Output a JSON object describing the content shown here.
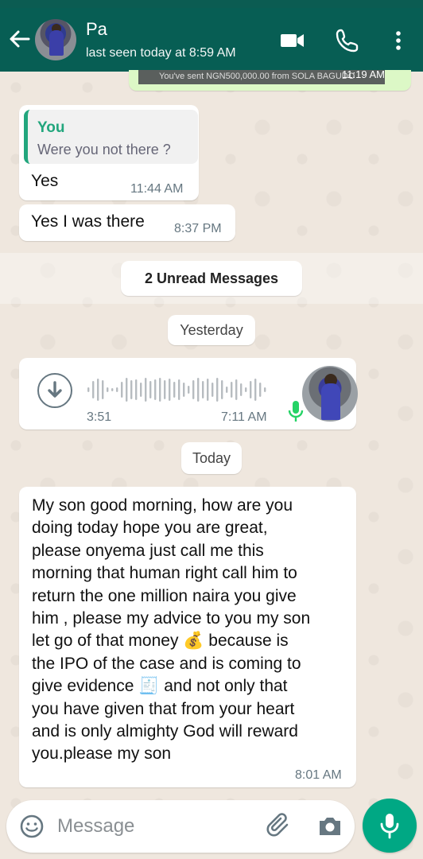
{
  "header": {
    "contact_name": "Pa",
    "last_seen": "last seen today at 8:59 AM"
  },
  "sent_preview": {
    "text": "You've sent NGN500,000.00 from SOLA BAGUDO",
    "time": "11:19 AM"
  },
  "messages": [
    {
      "reply_author": "You",
      "reply_text": "Were you not there ?",
      "text": "Yes",
      "time": "11:44 AM"
    },
    {
      "text": "Yes I was there",
      "time": "8:37 PM"
    }
  ],
  "unread_label": "2 Unread Messages",
  "date_yesterday": "Yesterday",
  "voice_note": {
    "duration": "3:51",
    "time": "7:11 AM"
  },
  "date_today": "Today",
  "long_message": {
    "text": "My son good morning, how are you\ndoing today hope you are great,\nplease onyema just call me this\nmorning that human right call him to\nreturn the one million naira you give\nhim , please my advice to you my son\nlet go of that money 💰 because is\nthe IPO of the case and is coming to\ngive evidence 🧾 and not only that\nyou have given that from your heart\nand is only almighty God will reward\nyou.please my son",
    "time": "8:01 AM"
  },
  "input": {
    "placeholder": "Message"
  },
  "icons": {
    "back": "arrow-left-icon",
    "video": "video-call-icon",
    "call": "phone-icon",
    "menu": "more-vert-icon",
    "download": "download-icon",
    "mic_small": "mic-icon",
    "emoji": "emoji-icon",
    "attach": "paperclip-icon",
    "camera": "camera-icon",
    "mic": "mic-icon"
  },
  "colors": {
    "header": "#075e54",
    "accent": "#00a884",
    "reply_accent": "#22a67d",
    "sent_bubble": "#dcf8c6"
  }
}
